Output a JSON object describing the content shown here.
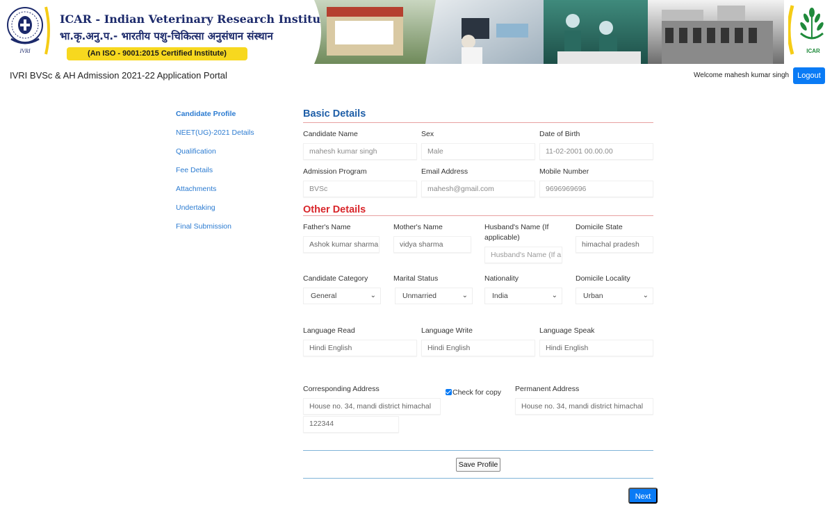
{
  "header": {
    "institute_name": "ICAR - Indian Veterinary Research Institute",
    "institute_hindi": "भा.कृ.अनु.प.- भारतीय पशु-चिकित्सा अनुसंधान संस्थान",
    "iso_badge": "(An ISO - 9001:2015 Certified Institute)",
    "ivri_logo_text": "IVRI",
    "icar_logo_text": "ICAR"
  },
  "topbar": {
    "portal_title": "IVRI BVSc & AH Admission 2021-22 Application Portal",
    "welcome": "Welcome mahesh kumar singh",
    "logout": "Logout"
  },
  "sidebar": {
    "items": [
      {
        "label": "Candidate Profile",
        "active": true
      },
      {
        "label": "NEET(UG)-2021 Details",
        "active": false
      },
      {
        "label": "Qualification",
        "active": false
      },
      {
        "label": "Fee Details",
        "active": false
      },
      {
        "label": "Attachments",
        "active": false
      },
      {
        "label": "Undertaking",
        "active": false
      },
      {
        "label": "Final Submission",
        "active": false
      }
    ]
  },
  "basic": {
    "heading": "Basic Details",
    "candidate_name": {
      "label": "Candidate Name",
      "value": "mahesh kumar singh"
    },
    "sex": {
      "label": "Sex",
      "value": "Male"
    },
    "dob": {
      "label": "Date of Birth",
      "value": "11-02-2001 00.00.00"
    },
    "program": {
      "label": "Admission Program",
      "value": "BVSc"
    },
    "email": {
      "label": "Email Address",
      "value": "mahesh@gmail.com"
    },
    "mobile": {
      "label": "Mobile Number",
      "value": "9696969696"
    }
  },
  "other": {
    "heading": "Other Details",
    "father": {
      "label": "Father's Name",
      "value": "Ashok kumar sharma"
    },
    "mother": {
      "label": "Mother's Name",
      "value": "vidya sharma"
    },
    "husband": {
      "label": "Husband's Name (If applicable)",
      "placeholder": "Husband's Name (If a"
    },
    "domicile_state": {
      "label": "Domicile State",
      "value": "himachal pradesh"
    },
    "category": {
      "label": "Candidate Category",
      "value": "General"
    },
    "marital": {
      "label": "Marital Status",
      "value": "Unmarried"
    },
    "nationality": {
      "label": "Nationality",
      "value": "India"
    },
    "locality": {
      "label": "Domicile Locality",
      "value": "Urban"
    },
    "lang_read": {
      "label": "Language Read",
      "value": "Hindi English"
    },
    "lang_write": {
      "label": "Language Write",
      "value": "Hindi English"
    },
    "lang_speak": {
      "label": "Language Speak",
      "value": "Hindi English"
    },
    "corr_address": {
      "label": "Corresponding Address",
      "value": "House no. 34, mandi district himachal",
      "pin": "122344"
    },
    "copy_check": {
      "label": "Check for copy",
      "checked": true
    },
    "perm_address": {
      "label": "Permanent Address",
      "value": "House no. 34, mandi district himachal"
    }
  },
  "actions": {
    "save": "Save Profile",
    "next": "Next"
  },
  "colors": {
    "primary_blue": "#0a7bf5",
    "link_blue": "#2b7bd1",
    "heading_blue": "#1f5fa8",
    "heading_red": "#d9262b",
    "brand_navy": "#1c2a6b",
    "iso_yellow": "#f7d81f"
  }
}
